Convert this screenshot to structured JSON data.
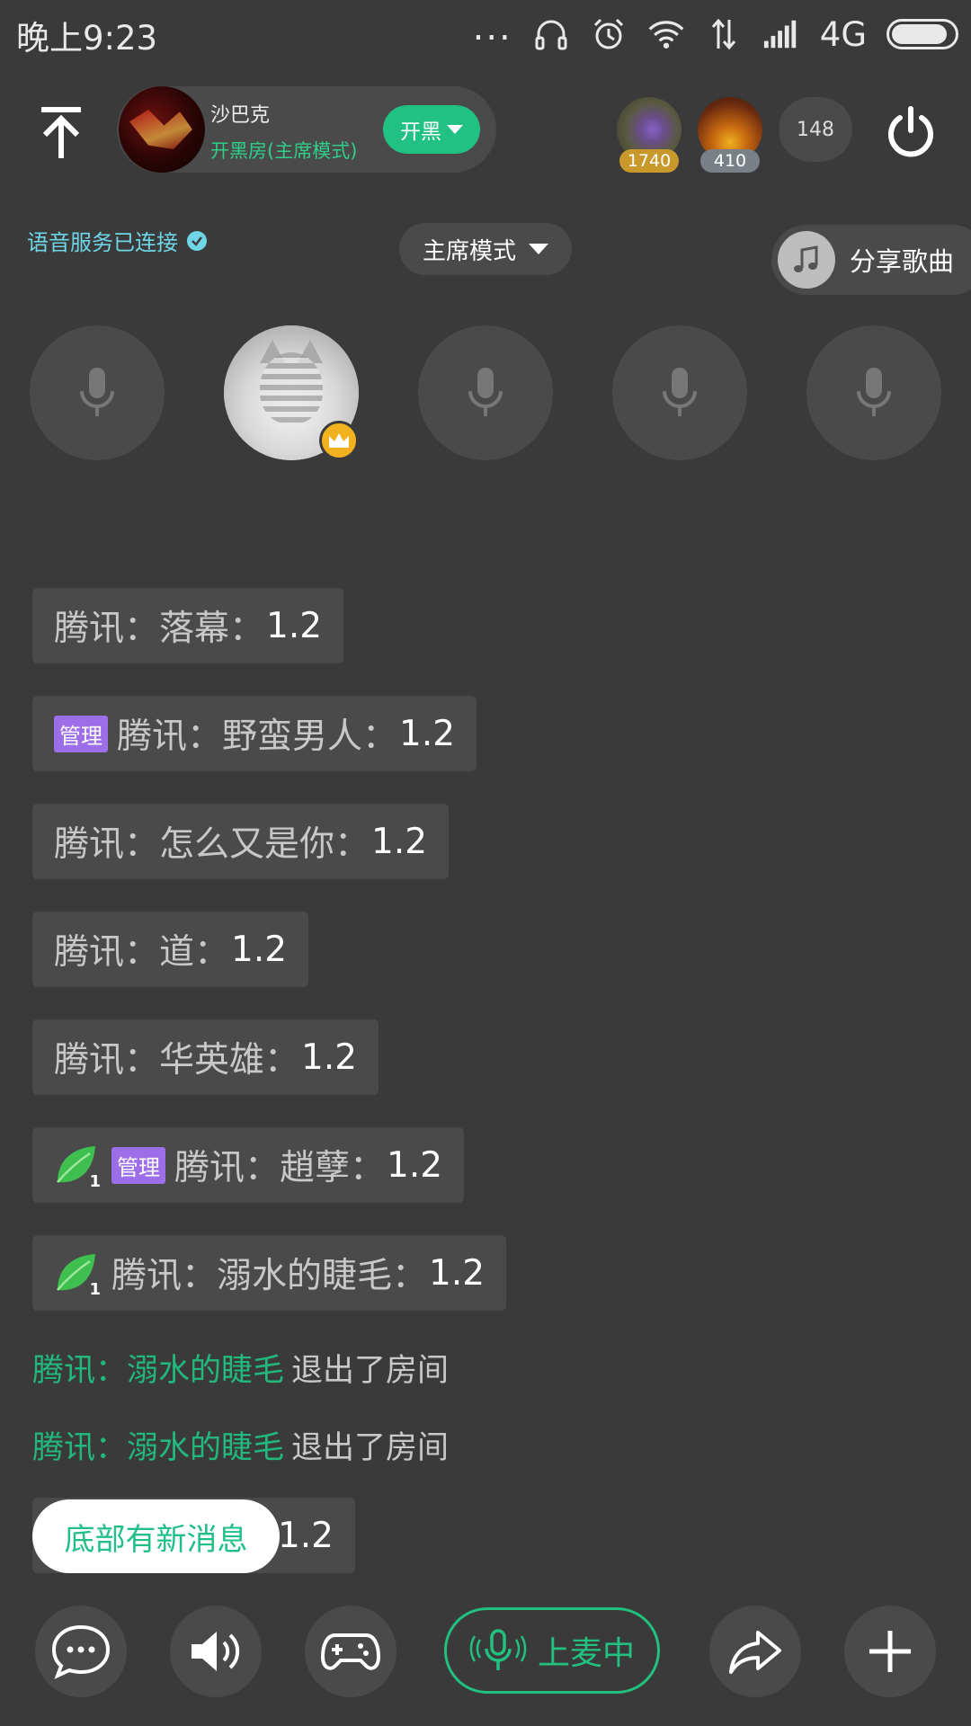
{
  "status_bar": {
    "time": "晚上9:23",
    "dots": "...",
    "network": "4G",
    "battery_level": 0.9
  },
  "header": {
    "room_name": "沙巴克",
    "room_subtitle": "开黑房(主席模式)",
    "kaihei_label": "开黑",
    "top_users": [
      {
        "score": "1740"
      },
      {
        "score": "410"
      }
    ],
    "online_count": "148"
  },
  "info": {
    "voice_status": "语音服务已连接",
    "mode_label": "主席模式",
    "share_song_label": "分享歌曲"
  },
  "chat": {
    "messages": [
      {
        "name": "腾讯：落幕：",
        "value": "1.2"
      },
      {
        "badge": "管理",
        "name": "腾讯：野蛮男人：",
        "value": "1.2"
      },
      {
        "name": "腾讯：怎么又是你：",
        "value": "1.2"
      },
      {
        "name": "腾讯：道：",
        "value": "1.2"
      },
      {
        "name": "腾讯：华英雄：",
        "value": "1.2"
      },
      {
        "leaf_level": "1",
        "badge": "管理",
        "name": "腾讯：趙孽：",
        "value": "1.2"
      },
      {
        "leaf_level": "1",
        "name": "腾讯：溺水的睫毛：",
        "value": "1.2"
      }
    ],
    "system_messages": [
      {
        "who": "腾讯：溺水的睫毛",
        "action": "退出了房间"
      },
      {
        "who": "腾讯：溺水的睫毛",
        "action": "退出了房间"
      }
    ],
    "partial_message": {
      "value": "1.2"
    },
    "new_message_toast": "底部有新消息"
  },
  "bottom_bar": {
    "mic_status_label": "上麦中"
  },
  "colors": {
    "accent": "#22c17f",
    "background": "#3a3a3a",
    "surface": "#4a4a4a",
    "admin_badge": "#9c6fe8",
    "voice_status": "#6ed6e6"
  }
}
